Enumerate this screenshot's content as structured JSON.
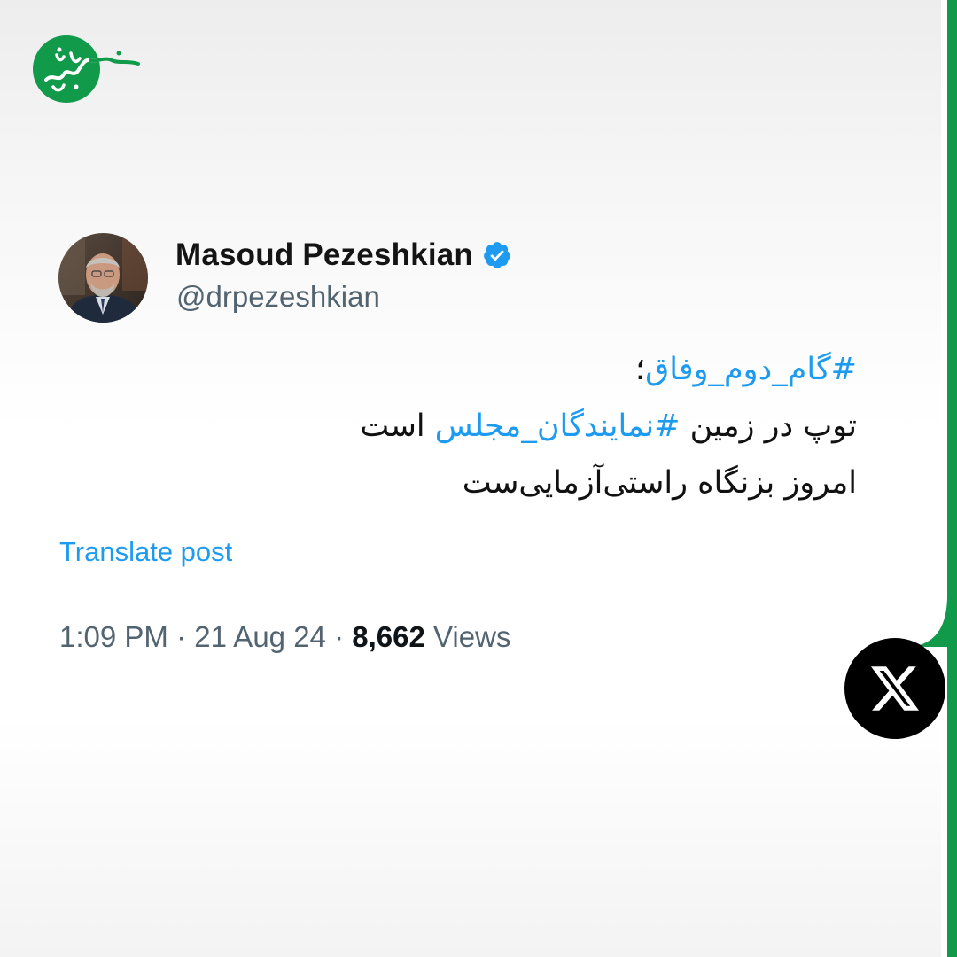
{
  "brand": {
    "logo_text": "خبرفوری",
    "accent_color": "#129a4b"
  },
  "author": {
    "name": "Masoud Pezeshkian",
    "handle": "@drpezeshkian",
    "verified": true,
    "verified_icon": "verified-badge-icon",
    "verified_color": "#1d9bf0"
  },
  "post": {
    "line1": {
      "hashtag": "#گام_دوم_وفاق",
      "after": "؛"
    },
    "line2": {
      "before": "توپ در زمین ",
      "hashtag": "#نمایندگان_مجلس",
      "after": " است"
    },
    "line3": "امروز بزنگاه راستی‌آزمایی‌ست",
    "hashtag_color": "#1d9bf0"
  },
  "translate_label": "Translate post",
  "meta": {
    "time": "1:09 PM",
    "date": "21 Aug 24",
    "separator": "·",
    "views_count": "8,662",
    "views_label": "Views"
  },
  "platform": {
    "icon": "x-logo-icon"
  }
}
